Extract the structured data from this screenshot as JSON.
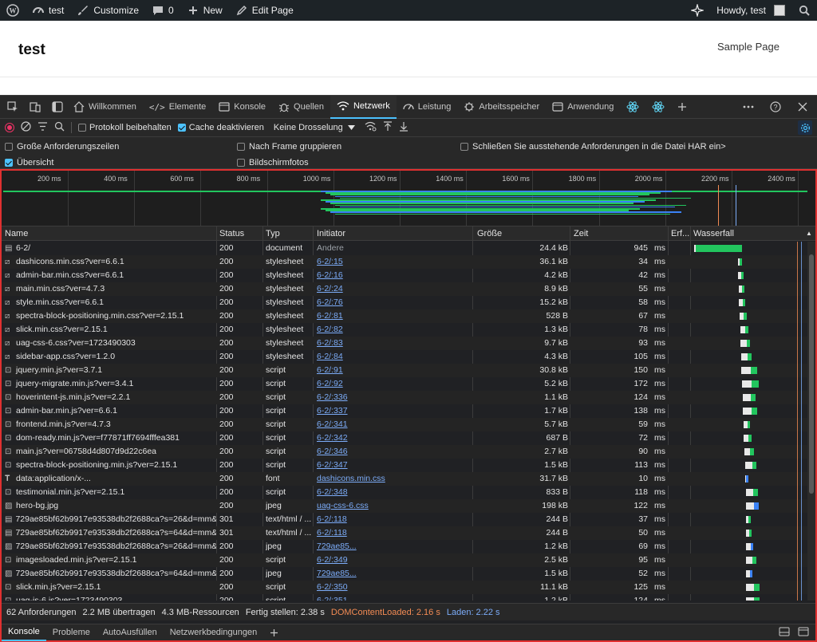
{
  "wp_bar": {
    "site_name": "test",
    "customize": "Customize",
    "comments_count": "0",
    "new": "New",
    "edit_page": "Edit Page",
    "howdy": "Howdy, test"
  },
  "page": {
    "site_title": "test",
    "nav_link": "Sample Page"
  },
  "devtools_tabs": [
    {
      "label": "Willkommen",
      "icon": "home-icon"
    },
    {
      "label": "Elemente",
      "icon": "code-icon"
    },
    {
      "label": "Konsole",
      "icon": "console-icon"
    },
    {
      "label": "Quellen",
      "icon": "bug-icon"
    },
    {
      "label": "Netzwerk",
      "icon": "wifi-icon",
      "active": true
    },
    {
      "label": "Leistung",
      "icon": "performance-icon"
    },
    {
      "label": "Arbeitsspeicher",
      "icon": "memory-icon"
    },
    {
      "label": "Anwendung",
      "icon": "application-icon"
    }
  ],
  "toolbar": {
    "preserve_log": "Protokoll beibehalten",
    "disable_cache": "Cache deaktivieren",
    "throttling": "Keine Drosselung"
  },
  "options": {
    "large_rows": "Große Anforderungszeilen",
    "group_by_frame": "Nach Frame gruppieren",
    "exclude_pending": "Schließen Sie ausstehende Anforderungen in die Datei HAR ein>",
    "overview": "Übersicht",
    "screenshots": "Bildschirmfotos"
  },
  "overview_ticks": [
    "200 ms",
    "400 ms",
    "600 ms",
    "800 ms",
    "1000 ms",
    "1200 ms",
    "1400 ms",
    "1600 ms",
    "1800 ms",
    "2000 ms",
    "2200 ms",
    "2400 ms"
  ],
  "columns": {
    "name": "Name",
    "status": "Status",
    "type": "Typ",
    "initiator": "Initiator",
    "size": "Größe",
    "time": "Zeit",
    "fulfilled": "Erf...",
    "waterfall": "Wasserfall"
  },
  "requests": [
    {
      "name": "6-2/",
      "status": "200",
      "type": "document",
      "initiator": "Andere",
      "size": "24.4 kB",
      "time": "945",
      "unit": "ms",
      "kind": "doc"
    },
    {
      "name": "dashicons.min.css?ver=6.6.1",
      "status": "200",
      "type": "stylesheet",
      "initiator": "6-2/:15",
      "size": "36.1 kB",
      "time": "34",
      "unit": "ms",
      "kind": "css"
    },
    {
      "name": "admin-bar.min.css?ver=6.6.1",
      "status": "200",
      "type": "stylesheet",
      "initiator": "6-2/:16",
      "size": "4.2 kB",
      "time": "42",
      "unit": "ms",
      "kind": "css"
    },
    {
      "name": "main.min.css?ver=4.7.3",
      "status": "200",
      "type": "stylesheet",
      "initiator": "6-2/:24",
      "size": "8.9 kB",
      "time": "55",
      "unit": "ms",
      "kind": "css"
    },
    {
      "name": "style.min.css?ver=6.6.1",
      "status": "200",
      "type": "stylesheet",
      "initiator": "6-2/:76",
      "size": "15.2 kB",
      "time": "58",
      "unit": "ms",
      "kind": "css"
    },
    {
      "name": "spectra-block-positioning.min.css?ver=2.15.1",
      "status": "200",
      "type": "stylesheet",
      "initiator": "6-2/:81",
      "size": "528 B",
      "time": "67",
      "unit": "ms",
      "kind": "css"
    },
    {
      "name": "slick.min.css?ver=2.15.1",
      "status": "200",
      "type": "stylesheet",
      "initiator": "6-2/:82",
      "size": "1.3 kB",
      "time": "78",
      "unit": "ms",
      "kind": "css"
    },
    {
      "name": "uag-css-6.css?ver=1723490303",
      "status": "200",
      "type": "stylesheet",
      "initiator": "6-2/:83",
      "size": "9.7 kB",
      "time": "93",
      "unit": "ms",
      "kind": "css"
    },
    {
      "name": "sidebar-app.css?ver=1.2.0",
      "status": "200",
      "type": "stylesheet",
      "initiator": "6-2/:84",
      "size": "4.3 kB",
      "time": "105",
      "unit": "ms",
      "kind": "css"
    },
    {
      "name": "jquery.min.js?ver=3.7.1",
      "status": "200",
      "type": "script",
      "initiator": "6-2/:91",
      "size": "30.8 kB",
      "time": "150",
      "unit": "ms",
      "kind": "js"
    },
    {
      "name": "jquery-migrate.min.js?ver=3.4.1",
      "status": "200",
      "type": "script",
      "initiator": "6-2/:92",
      "size": "5.2 kB",
      "time": "172",
      "unit": "ms",
      "kind": "js"
    },
    {
      "name": "hoverintent-js.min.js?ver=2.2.1",
      "status": "200",
      "type": "script",
      "initiator": "6-2/:336",
      "size": "1.1 kB",
      "time": "124",
      "unit": "ms",
      "kind": "js"
    },
    {
      "name": "admin-bar.min.js?ver=6.6.1",
      "status": "200",
      "type": "script",
      "initiator": "6-2/:337",
      "size": "1.7 kB",
      "time": "138",
      "unit": "ms",
      "kind": "js"
    },
    {
      "name": "frontend.min.js?ver=4.7.3",
      "status": "200",
      "type": "script",
      "initiator": "6-2/:341",
      "size": "5.7 kB",
      "time": "59",
      "unit": "ms",
      "kind": "js"
    },
    {
      "name": "dom-ready.min.js?ver=f77871ff7694fffea381",
      "status": "200",
      "type": "script",
      "initiator": "6-2/:342",
      "size": "687 B",
      "time": "72",
      "unit": "ms",
      "kind": "js"
    },
    {
      "name": "main.js?ver=06758d4d807d9d22c6ea",
      "status": "200",
      "type": "script",
      "initiator": "6-2/:346",
      "size": "2.7 kB",
      "time": "90",
      "unit": "ms",
      "kind": "js"
    },
    {
      "name": "spectra-block-positioning.min.js?ver=2.15.1",
      "status": "200",
      "type": "script",
      "initiator": "6-2/:347",
      "size": "1.5 kB",
      "time": "113",
      "unit": "ms",
      "kind": "js"
    },
    {
      "name": "data:application/x-...",
      "status": "200",
      "type": "font",
      "initiator": "dashicons.min.css",
      "size": "31.7 kB",
      "time": "10",
      "unit": "ms",
      "kind": "font"
    },
    {
      "name": "testimonial.min.js?ver=2.15.1",
      "status": "200",
      "type": "script",
      "initiator": "6-2/:348",
      "size": "833 B",
      "time": "118",
      "unit": "ms",
      "kind": "js"
    },
    {
      "name": "hero-bg.jpg",
      "status": "200",
      "type": "jpeg",
      "initiator": "uag-css-6.css",
      "size": "198 kB",
      "time": "122",
      "unit": "ms",
      "kind": "img"
    },
    {
      "name": "729ae85bf62b9917e93538db2f2688ca?s=26&d=mm&r...",
      "status": "301",
      "type": "text/html / ...",
      "initiator": "6-2/:118",
      "size": "244 B",
      "time": "37",
      "unit": "ms",
      "kind": "doc"
    },
    {
      "name": "729ae85bf62b9917e93538db2f2688ca?s=64&d=mm&r...",
      "status": "301",
      "type": "text/html / ...",
      "initiator": "6-2/:118",
      "size": "244 B",
      "time": "50",
      "unit": "ms",
      "kind": "doc"
    },
    {
      "name": "729ae85bf62b9917e93538db2f2688ca?s=26&d=mm&r...",
      "status": "200",
      "type": "jpeg",
      "initiator": "729ae85...",
      "size": "1.2 kB",
      "time": "69",
      "unit": "ms",
      "kind": "img"
    },
    {
      "name": "imagesloaded.min.js?ver=2.15.1",
      "status": "200",
      "type": "script",
      "initiator": "6-2/:349",
      "size": "2.5 kB",
      "time": "95",
      "unit": "ms",
      "kind": "js"
    },
    {
      "name": "729ae85bf62b9917e93538db2f2688ca?s=64&d=mm&r...",
      "status": "200",
      "type": "jpeg",
      "initiator": "729ae85...",
      "size": "1.5 kB",
      "time": "52",
      "unit": "ms",
      "kind": "img"
    },
    {
      "name": "slick.min.js?ver=2.15.1",
      "status": "200",
      "type": "script",
      "initiator": "6-2/:350",
      "size": "11.1 kB",
      "time": "125",
      "unit": "ms",
      "kind": "js"
    },
    {
      "name": "uag-js-6.js?ver=1723490303",
      "status": "200",
      "type": "script",
      "initiator": "6-2/:351",
      "size": "1.2 kB",
      "time": "124",
      "unit": "ms",
      "kind": "js"
    }
  ],
  "summary": {
    "requests": "62 Anforderungen",
    "transferred": "2.2 MB übertragen",
    "resources": "4.3 MB-Ressourcen",
    "finish": "Fertig stellen: 2.38 s",
    "dcl": "DOMContentLoaded: 2.16 s",
    "load": "Laden: 2.22 s"
  },
  "drawer_tabs": [
    "Konsole",
    "Probleme",
    "AutoAusfüllen",
    "Netzwerkbedingungen"
  ],
  "colors": {
    "accent": "#4cc2ff",
    "dcl": "#f28b54",
    "load": "#7cacf8",
    "waterfall_green": "#22c55e",
    "border_highlight": "#e03030"
  }
}
